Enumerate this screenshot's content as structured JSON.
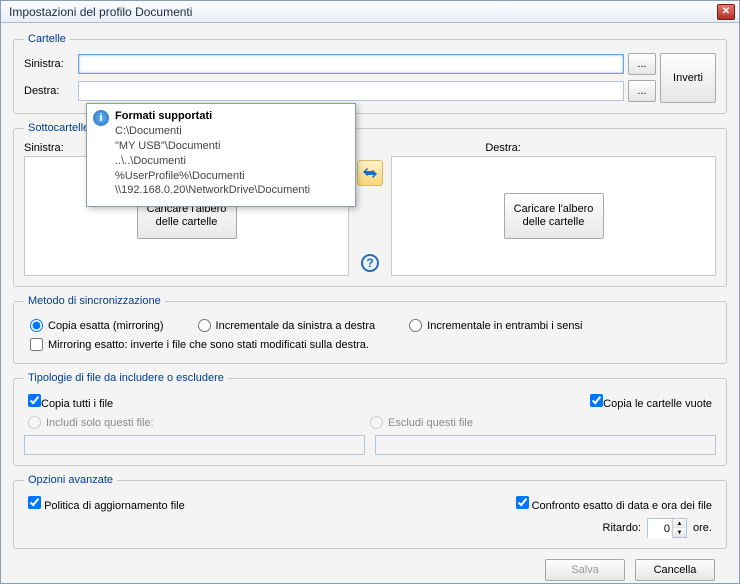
{
  "window": {
    "title": "Impostazioni del profilo Documenti"
  },
  "folders": {
    "legend": "Cartelle",
    "leftLabel": "Sinistra:",
    "rightLabel": "Destra:",
    "leftValue": "",
    "rightValue": "",
    "browse": "...",
    "invert": "Inverti"
  },
  "tooltip": {
    "title": "Formati supportati",
    "lines": [
      "C:\\Documenti",
      "\"MY USB\"\\Documenti",
      "..\\..\\Documenti",
      "%UserProfile%\\Documenti",
      "\\\\192.168.0.20\\NetworkDrive\\Documenti"
    ]
  },
  "subfolders": {
    "legend": "Sottocartelle",
    "leftLabel": "Sinistra:",
    "rightLabel": "Destra:",
    "loadButton": "Caricare l'albero delle cartelle"
  },
  "syncMethod": {
    "legend": "Metodo di sincronizzazione",
    "opt1": "Copia esatta (mirroring)",
    "opt2": "Incrementale da sinistra a destra",
    "opt3": "Incrementale in entrambi i sensi",
    "mirror": "Mirroring esatto: inverte i file che sono stati modificati sulla destra."
  },
  "fileTypes": {
    "legend": "Tipologie di file da includere o escludere",
    "copyAll": "Copia tutti i file",
    "copyEmpty": "Copia le cartelle vuote",
    "includeOnly": "Includi solo questi file:",
    "exclude": "Escludi questi file"
  },
  "advanced": {
    "legend": "Opzioni avanzate",
    "policy": "Politica di aggiornamento file",
    "compare": "Confronto esatto di data e ora dei file",
    "delayLabel": "Ritardo:",
    "delayValue": "0",
    "delayUnit": "ore."
  },
  "footer": {
    "save": "Salva",
    "cancel": "Cancella"
  }
}
